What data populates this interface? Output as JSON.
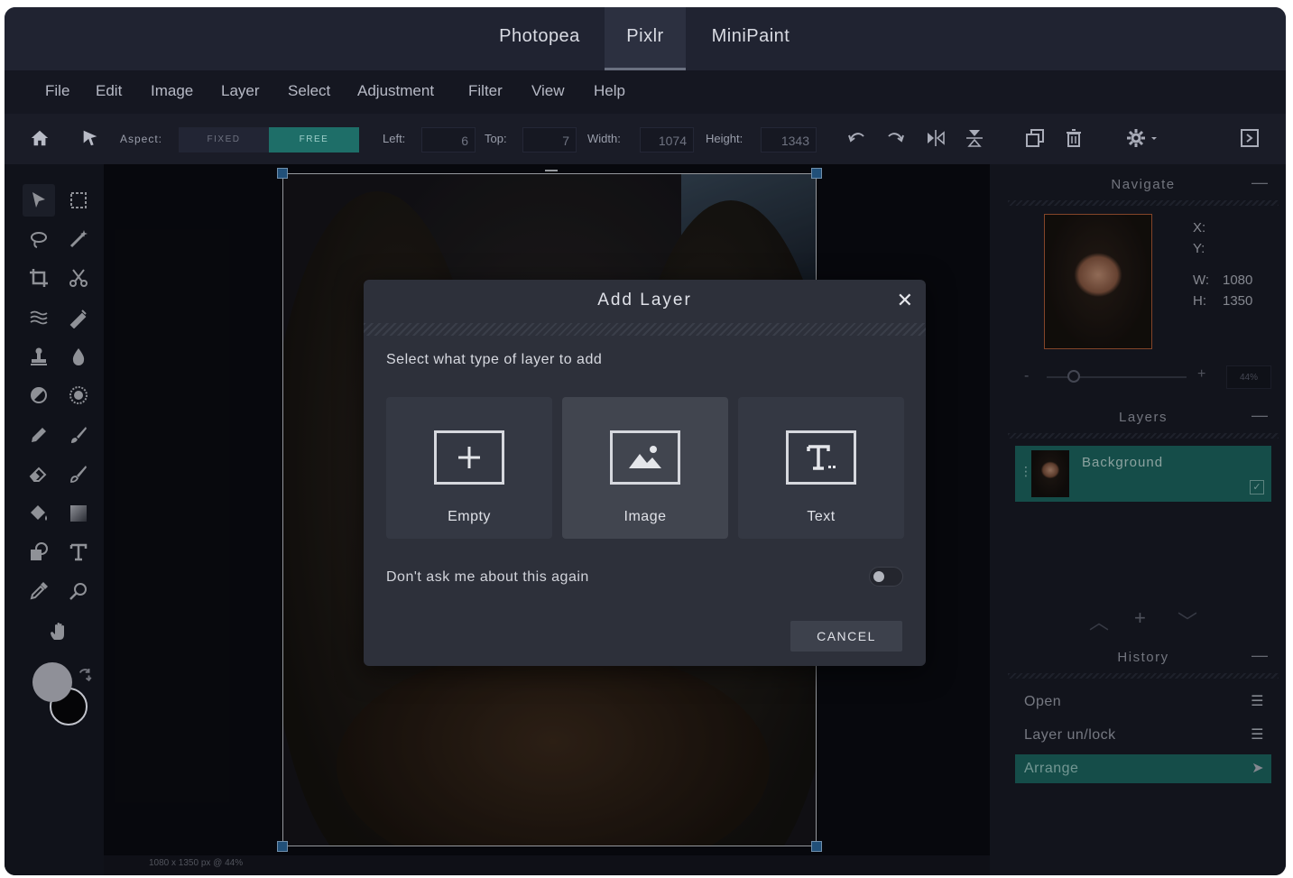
{
  "app_tabs": [
    {
      "label": "Photopea",
      "active": false
    },
    {
      "label": "Pixlr",
      "active": true
    },
    {
      "label": "MiniPaint",
      "active": false
    }
  ],
  "menu": [
    "File",
    "Edit",
    "Image",
    "Layer",
    "Select",
    "Adjustment",
    "Filter",
    "View",
    "Help"
  ],
  "toolbar": {
    "aspect_label": "Aspect:",
    "aspect_fixed": "FIXED",
    "aspect_free": "FREE",
    "left_label": "Left:",
    "left_value": "6",
    "top_label": "Top:",
    "top_value": "7",
    "width_label": "Width:",
    "width_value": "1074",
    "height_label": "Height:",
    "height_value": "1343"
  },
  "canvas": {
    "status": "1080 x 1350 px @ 44%"
  },
  "navigate": {
    "title": "Navigate",
    "x_label": "X:",
    "y_label": "Y:",
    "w_label": "W:",
    "w_value": "1080",
    "h_label": "H:",
    "h_value": "1350",
    "zoom_value": "44%"
  },
  "layers": {
    "title": "Layers",
    "items": [
      {
        "name": "Background"
      }
    ]
  },
  "history": {
    "title": "History",
    "items": [
      {
        "label": "Open",
        "current": false
      },
      {
        "label": "Layer un/lock",
        "current": false
      },
      {
        "label": "Arrange",
        "current": true
      }
    ]
  },
  "modal": {
    "title": "Add Layer",
    "subtitle": "Select what type of layer to add",
    "options": [
      {
        "label": "Empty",
        "icon": "plus-icon"
      },
      {
        "label": "Image",
        "icon": "image-icon"
      },
      {
        "label": "Text",
        "icon": "text-icon"
      }
    ],
    "dont_ask": "Don't ask me about this again",
    "dont_ask_enabled": false,
    "cancel": "CANCEL"
  },
  "colors": {
    "accent": "#1e6b66",
    "handle": "#2f6fa8"
  }
}
